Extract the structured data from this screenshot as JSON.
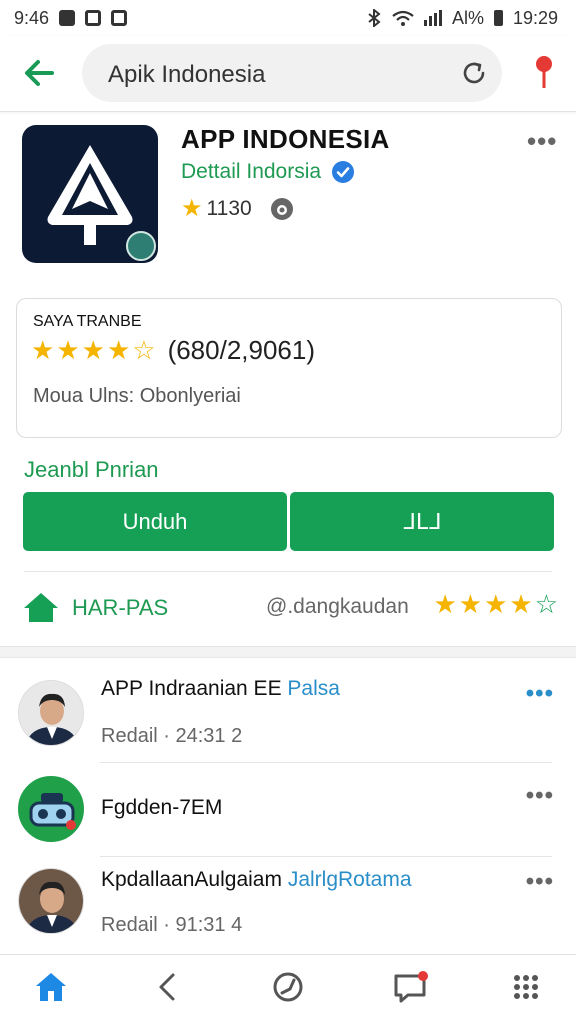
{
  "status_bar": {
    "time_left": "9:46",
    "signal_text": "Al%",
    "time_right": "19:29"
  },
  "search": {
    "query": "Apik Indonesia"
  },
  "app": {
    "title": "APP INDONESIA",
    "developer": "Dettail Indorsia",
    "rating": "1130"
  },
  "ratings_card": {
    "label": "SAYA TRANBE",
    "stars": 3.5,
    "count": "(680/2,9061)",
    "info": "Moua Ulns: Obonlyeriai"
  },
  "install": {
    "section_label": "Jeanbl Pnrian",
    "download_label": "Unduh",
    "second_label": "ᒧᒪᒧ"
  },
  "meta": {
    "code": "HAR-PAS",
    "user": "@.dangkaudan",
    "stars": 3.5
  },
  "list": [
    {
      "title": "APP Indraanian EE",
      "tag": "Palsa",
      "subtitle": "Redail · 24:31 2"
    },
    {
      "title": "Fgdden-7EM",
      "tag": "",
      "subtitle": ""
    },
    {
      "title": "KpdallaanAulgaiam",
      "tag": "JalrlgRotama",
      "subtitle": "Redail · 91:31 4"
    }
  ],
  "colors": {
    "accent_green": "#15a056",
    "link_blue": "#2a8ec9",
    "star_yellow": "#f4b400",
    "notification_red": "#e53935"
  },
  "icons": {
    "back": "arrow-left",
    "refresh": "refresh",
    "location": "map-pin",
    "verified": "check-badge",
    "more": "more-horizontal",
    "home": "home",
    "nav_back": "chevron-left",
    "compass": "compass",
    "notifications": "message",
    "apps": "grid"
  }
}
